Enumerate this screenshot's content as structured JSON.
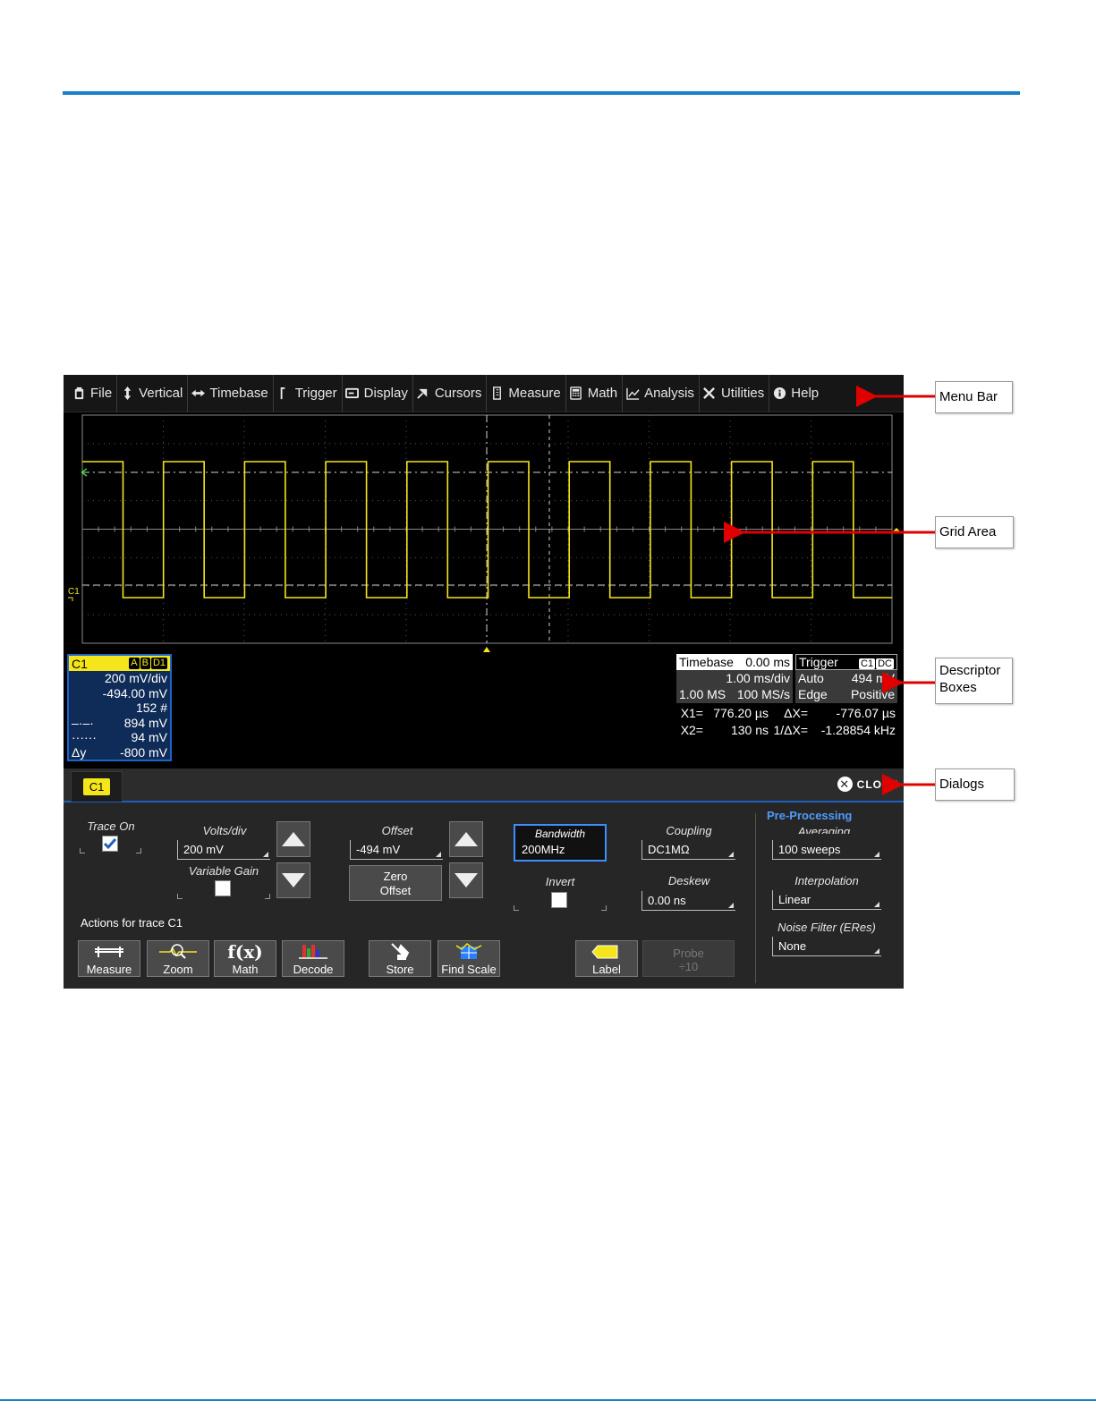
{
  "menubar": {
    "items": [
      {
        "label": "File",
        "icon": "clipboard-icon"
      },
      {
        "label": "Vertical",
        "icon": "vertical-arrows-icon"
      },
      {
        "label": "Timebase",
        "icon": "horizontal-arrows-icon"
      },
      {
        "label": "Trigger",
        "icon": "trigger-icon"
      },
      {
        "label": "Display",
        "icon": "display-icon"
      },
      {
        "label": "Cursors",
        "icon": "cursor-icon"
      },
      {
        "label": "Measure",
        "icon": "measure-icon"
      },
      {
        "label": "Math",
        "icon": "calculator-icon"
      },
      {
        "label": "Analysis",
        "icon": "chart-icon"
      },
      {
        "label": "Utilities",
        "icon": "tools-icon"
      },
      {
        "label": "Help",
        "icon": "info-icon"
      }
    ]
  },
  "grid": {
    "trace_label": "C1",
    "trace_color": "#f4e61a"
  },
  "c1_descriptor": {
    "title": "C1",
    "badges": [
      "A",
      "B",
      "D1"
    ],
    "rows": [
      {
        "l": "",
        "r": "200 mV/div"
      },
      {
        "l": "",
        "r": "-494.00 mV"
      },
      {
        "l": "",
        "r": "152 #"
      },
      {
        "l": "–·–·",
        "r": "894 mV"
      },
      {
        "l": "······",
        "r": "94 mV"
      },
      {
        "l": "Δy",
        "r": "-800 mV"
      }
    ]
  },
  "timebase_descriptor": {
    "title": "Timebase",
    "delay": "0.00 ms",
    "row1": {
      "l": "",
      "r": "1.00 ms/div"
    },
    "row2": {
      "l": "1.00 MS",
      "r": "100 MS/s"
    }
  },
  "trigger_descriptor": {
    "title": "Trigger",
    "badges": [
      "C1",
      "DC"
    ],
    "row1": {
      "l": "Auto",
      "r": "494 mV"
    },
    "row2": {
      "l": "Edge",
      "r": "Positive"
    }
  },
  "cursor_readout": {
    "row1": {
      "a": "X1=",
      "b": "776.20 µs",
      "c": "ΔX=",
      "d": "-776.07 µs"
    },
    "row2": {
      "a": "X2=",
      "b": "130 ns",
      "c": "1/ΔX=",
      "d": "-1.28854 kHz"
    }
  },
  "dialog": {
    "tab": "C1",
    "close": "CLOSE",
    "trace_on": "Trace On",
    "volts_div_label": "Volts/div",
    "volts_div_value": "200 mV",
    "variable_gain": "Variable Gain",
    "offset_label": "Offset",
    "offset_value": "-494 mV",
    "zero_offset_1": "Zero",
    "zero_offset_2": "Offset",
    "bandwidth_label": "Bandwidth",
    "bandwidth_value": "200MHz",
    "coupling_label": "Coupling",
    "coupling_value": "DC1MΩ",
    "invert_label": "Invert",
    "deskew_label": "Deskew",
    "deskew_value": "0.00 ns",
    "pre_processing": "Pre-Processing",
    "averaging_label": "Averaging",
    "averaging_value": "100 sweeps",
    "interpolation_label": "Interpolation",
    "interpolation_value": "Linear",
    "noise_filter_label": "Noise Filter (ERes)",
    "noise_filter_value": "None",
    "actions_title": "Actions for trace C1",
    "actions": [
      "Measure",
      "Zoom",
      "Math",
      "Decode",
      "Store",
      "Find Scale",
      "Label"
    ],
    "probe_1": "Probe",
    "probe_2": "÷10"
  },
  "callouts": {
    "menu_bar": "Menu Bar",
    "grid_area": "Grid Area",
    "descriptor_1": "Descriptor",
    "descriptor_2": "Boxes",
    "dialogs": "Dialogs"
  },
  "colors": {
    "accent": "#1a7fc9",
    "trace": "#f4e61a",
    "arrow": "#e00000",
    "highlight": "#3b8fff"
  }
}
